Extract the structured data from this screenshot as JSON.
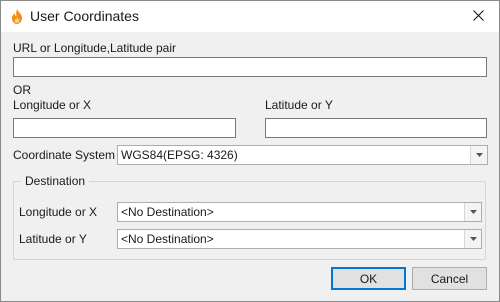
{
  "window": {
    "title": "User Coordinates",
    "icon": "flame-icon",
    "close_icon": "close-icon"
  },
  "url_field": {
    "label": "URL or Longitude,Latitude pair",
    "value": ""
  },
  "or_label": "OR",
  "longitude_field": {
    "label": "Longitude or X",
    "value": ""
  },
  "latitude_field": {
    "label": "Latitude or Y",
    "value": ""
  },
  "coordinate_system": {
    "label": "Coordinate System",
    "selected": "WGS84(EPSG: 4326)"
  },
  "destination": {
    "legend": "Destination",
    "longitude": {
      "label": "Longitude or X",
      "selected": "<No Destination>"
    },
    "latitude": {
      "label": "Latitude or Y",
      "selected": "<No Destination>"
    }
  },
  "buttons": {
    "ok": "OK",
    "cancel": "Cancel"
  },
  "colors": {
    "accent": "#0078d7",
    "icon_orange": "#f28c1c"
  }
}
